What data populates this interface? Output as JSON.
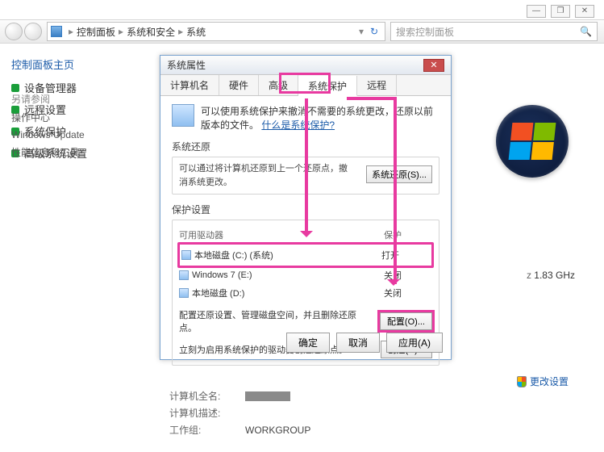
{
  "window_controls": {
    "min": "—",
    "max": "❐",
    "close": "✕"
  },
  "breadcrumb": {
    "items": [
      "控制面板",
      "系统和安全",
      "系统"
    ],
    "refresh": "↻",
    "search_placeholder": "搜索控制面板"
  },
  "sidebar": {
    "header": "控制面板主页",
    "items": [
      {
        "label": "设备管理器"
      },
      {
        "label": "远程设置"
      },
      {
        "label": "系统保护"
      },
      {
        "label": "高级系统设置"
      }
    ],
    "bottom": {
      "title": "另请参阅",
      "items": [
        "操作中心",
        "Windows Update",
        "性能信息和工具"
      ]
    }
  },
  "dialog": {
    "title": "系统属性",
    "tabs": [
      "计算机名",
      "硬件",
      "高级",
      "系统保护",
      "远程"
    ],
    "active_tab_index": 3,
    "lead": {
      "text1": "可以使用系统保护来撤消不需要的系统更改，还原以前版本的文件。",
      "link": "什么是系统保护?"
    },
    "restore_section": {
      "title": "系统还原",
      "note": "可以通过将计算机还原到上一个还原点，撤消系统更改。",
      "button": "系统还原(S)..."
    },
    "protect_section": {
      "title": "保护设置",
      "columns": {
        "drive": "可用驱动器",
        "status": "保护"
      },
      "rows": [
        {
          "label": "本地磁盘 (C:) (系统)",
          "status": "打开",
          "highlight": true
        },
        {
          "label": "Windows 7 (E:)",
          "status": "关闭",
          "highlight": false
        },
        {
          "label": "本地磁盘 (D:)",
          "status": "关闭",
          "highlight": false
        }
      ],
      "config_note": "配置还原设置、管理磁盘空间，并且删除还原点。",
      "config_button": "配置(O)...",
      "create_note": "立刻为启用系统保护的驱动器创建还原点。",
      "create_button": "创建(C)..."
    },
    "footer": {
      "ok": "确定",
      "cancel": "取消",
      "apply": "应用(A)"
    }
  },
  "right_info": {
    "cpu_hz": "1.83 GHz"
  },
  "change_link": "更改设置",
  "bottom_info": {
    "rows": [
      {
        "label": "计算机全名:",
        "masked": true
      },
      {
        "label": "计算机描述:",
        "value": ""
      },
      {
        "label": "工作组:",
        "value": "WORKGROUP"
      }
    ]
  }
}
